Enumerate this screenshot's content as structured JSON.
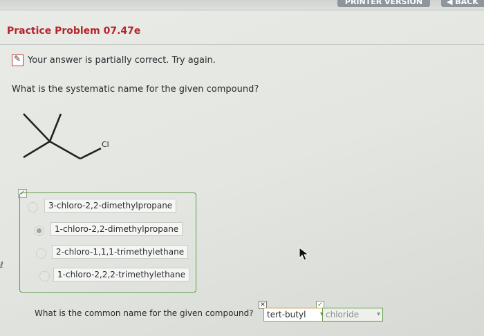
{
  "header": {
    "printer_version": "PRINTER VERSION",
    "back": "◀ BACK"
  },
  "problem": {
    "title": "Practice Problem 07.47e",
    "status_text": "Your answer is partially correct.  Try again.",
    "question": "What is the systematic name for the given compound?",
    "molecule_label": "Cl",
    "options": [
      {
        "label": "3-chloro-2,2-dimethylpropane",
        "selected": false
      },
      {
        "label": "1-chloro-2,2-dimethylpropane",
        "selected": true
      },
      {
        "label": "2-chloro-1,1,1-trimethylethane",
        "selected": false
      },
      {
        "label": "1-chloro-2,2,2-trimethylethane",
        "selected": false
      }
    ],
    "common_name_question": "What is the common name for the given compound?",
    "common_name_part1": "tert-butyl",
    "common_name_part2": "chloride"
  },
  "icons": {
    "partial": "pencil-icon",
    "cursor": "mouse-pointer-icon"
  },
  "colors": {
    "title": "#b5242b",
    "correct_border": "#5f9a48",
    "incorrect_border": "#d08a3a"
  }
}
